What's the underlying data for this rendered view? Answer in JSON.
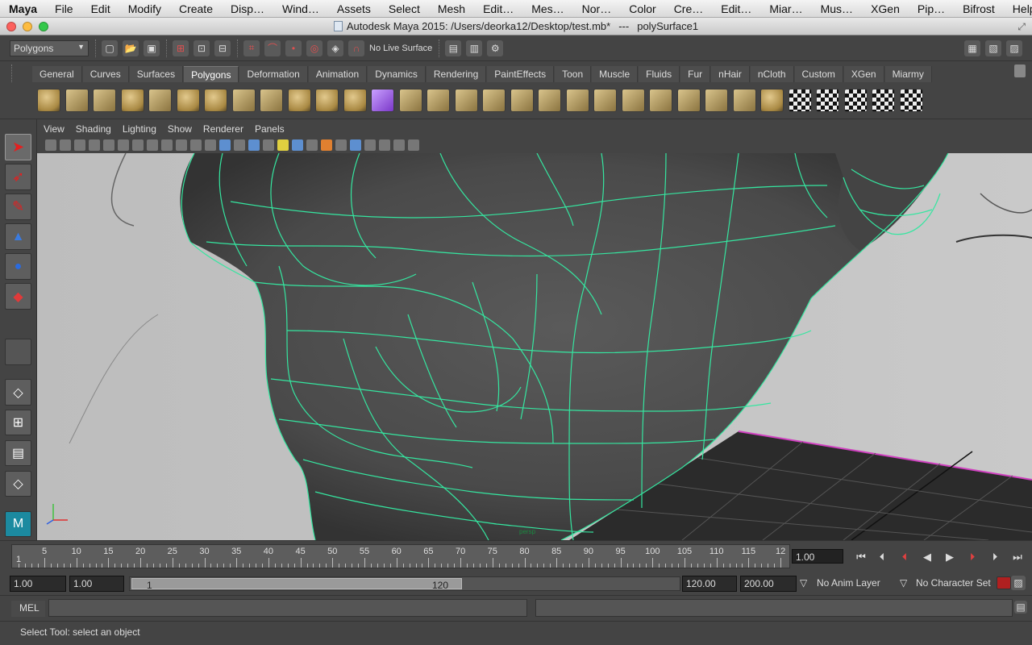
{
  "menubar": {
    "items": [
      "Maya",
      "File",
      "Edit",
      "Modify",
      "Create",
      "Disp…",
      "Wind…",
      "Assets",
      "Select",
      "Mesh",
      "Edit…",
      "Mes…",
      "Nor…",
      "Color",
      "Cre…",
      "Edit…",
      "Miar…",
      "Mus…",
      "XGen",
      "Pip…",
      "Bifrost",
      "Help"
    ]
  },
  "window": {
    "title": "Autodesk Maya 2015: /Users/deorka12/Desktop/test.mb*",
    "separator": "---",
    "object": "polySurface1"
  },
  "statusline": {
    "mode": "Polygons",
    "live_surface": "No Live Surface"
  },
  "shelf": {
    "tabs": [
      "General",
      "Curves",
      "Surfaces",
      "Polygons",
      "Deformation",
      "Animation",
      "Dynamics",
      "Rendering",
      "PaintEffects",
      "Toon",
      "Muscle",
      "Fluids",
      "Fur",
      "nHair",
      "nCloth",
      "Custom",
      "XGen",
      "Miarmy"
    ],
    "active_tab": "Polygons"
  },
  "panel": {
    "menus": [
      "View",
      "Shading",
      "Lighting",
      "Show",
      "Renderer",
      "Panels"
    ],
    "camera_label": "persp"
  },
  "timeslider": {
    "ticks": [
      "5",
      "10",
      "15",
      "20",
      "25",
      "30",
      "35",
      "40",
      "45",
      "50",
      "55",
      "60",
      "65",
      "70",
      "75",
      "80",
      "85",
      "90",
      "95",
      "100",
      "105",
      "110",
      "115",
      "12"
    ],
    "start_mark": "1",
    "current_frame": "1.00"
  },
  "range": {
    "start": "1.00",
    "playback_start": "1.00",
    "range_start_label": "1",
    "range_end_label": "120",
    "playback_end": "120.00",
    "end": "200.00",
    "anim_layer": "No Anim Layer",
    "character_set": "No Character Set"
  },
  "cmdline": {
    "label": "MEL"
  },
  "helpline": {
    "text": "Select Tool: select an object"
  },
  "colors": {
    "wire": "#35e6a0",
    "ui_bg": "#444444",
    "selection_magenta": "#d040c0"
  }
}
